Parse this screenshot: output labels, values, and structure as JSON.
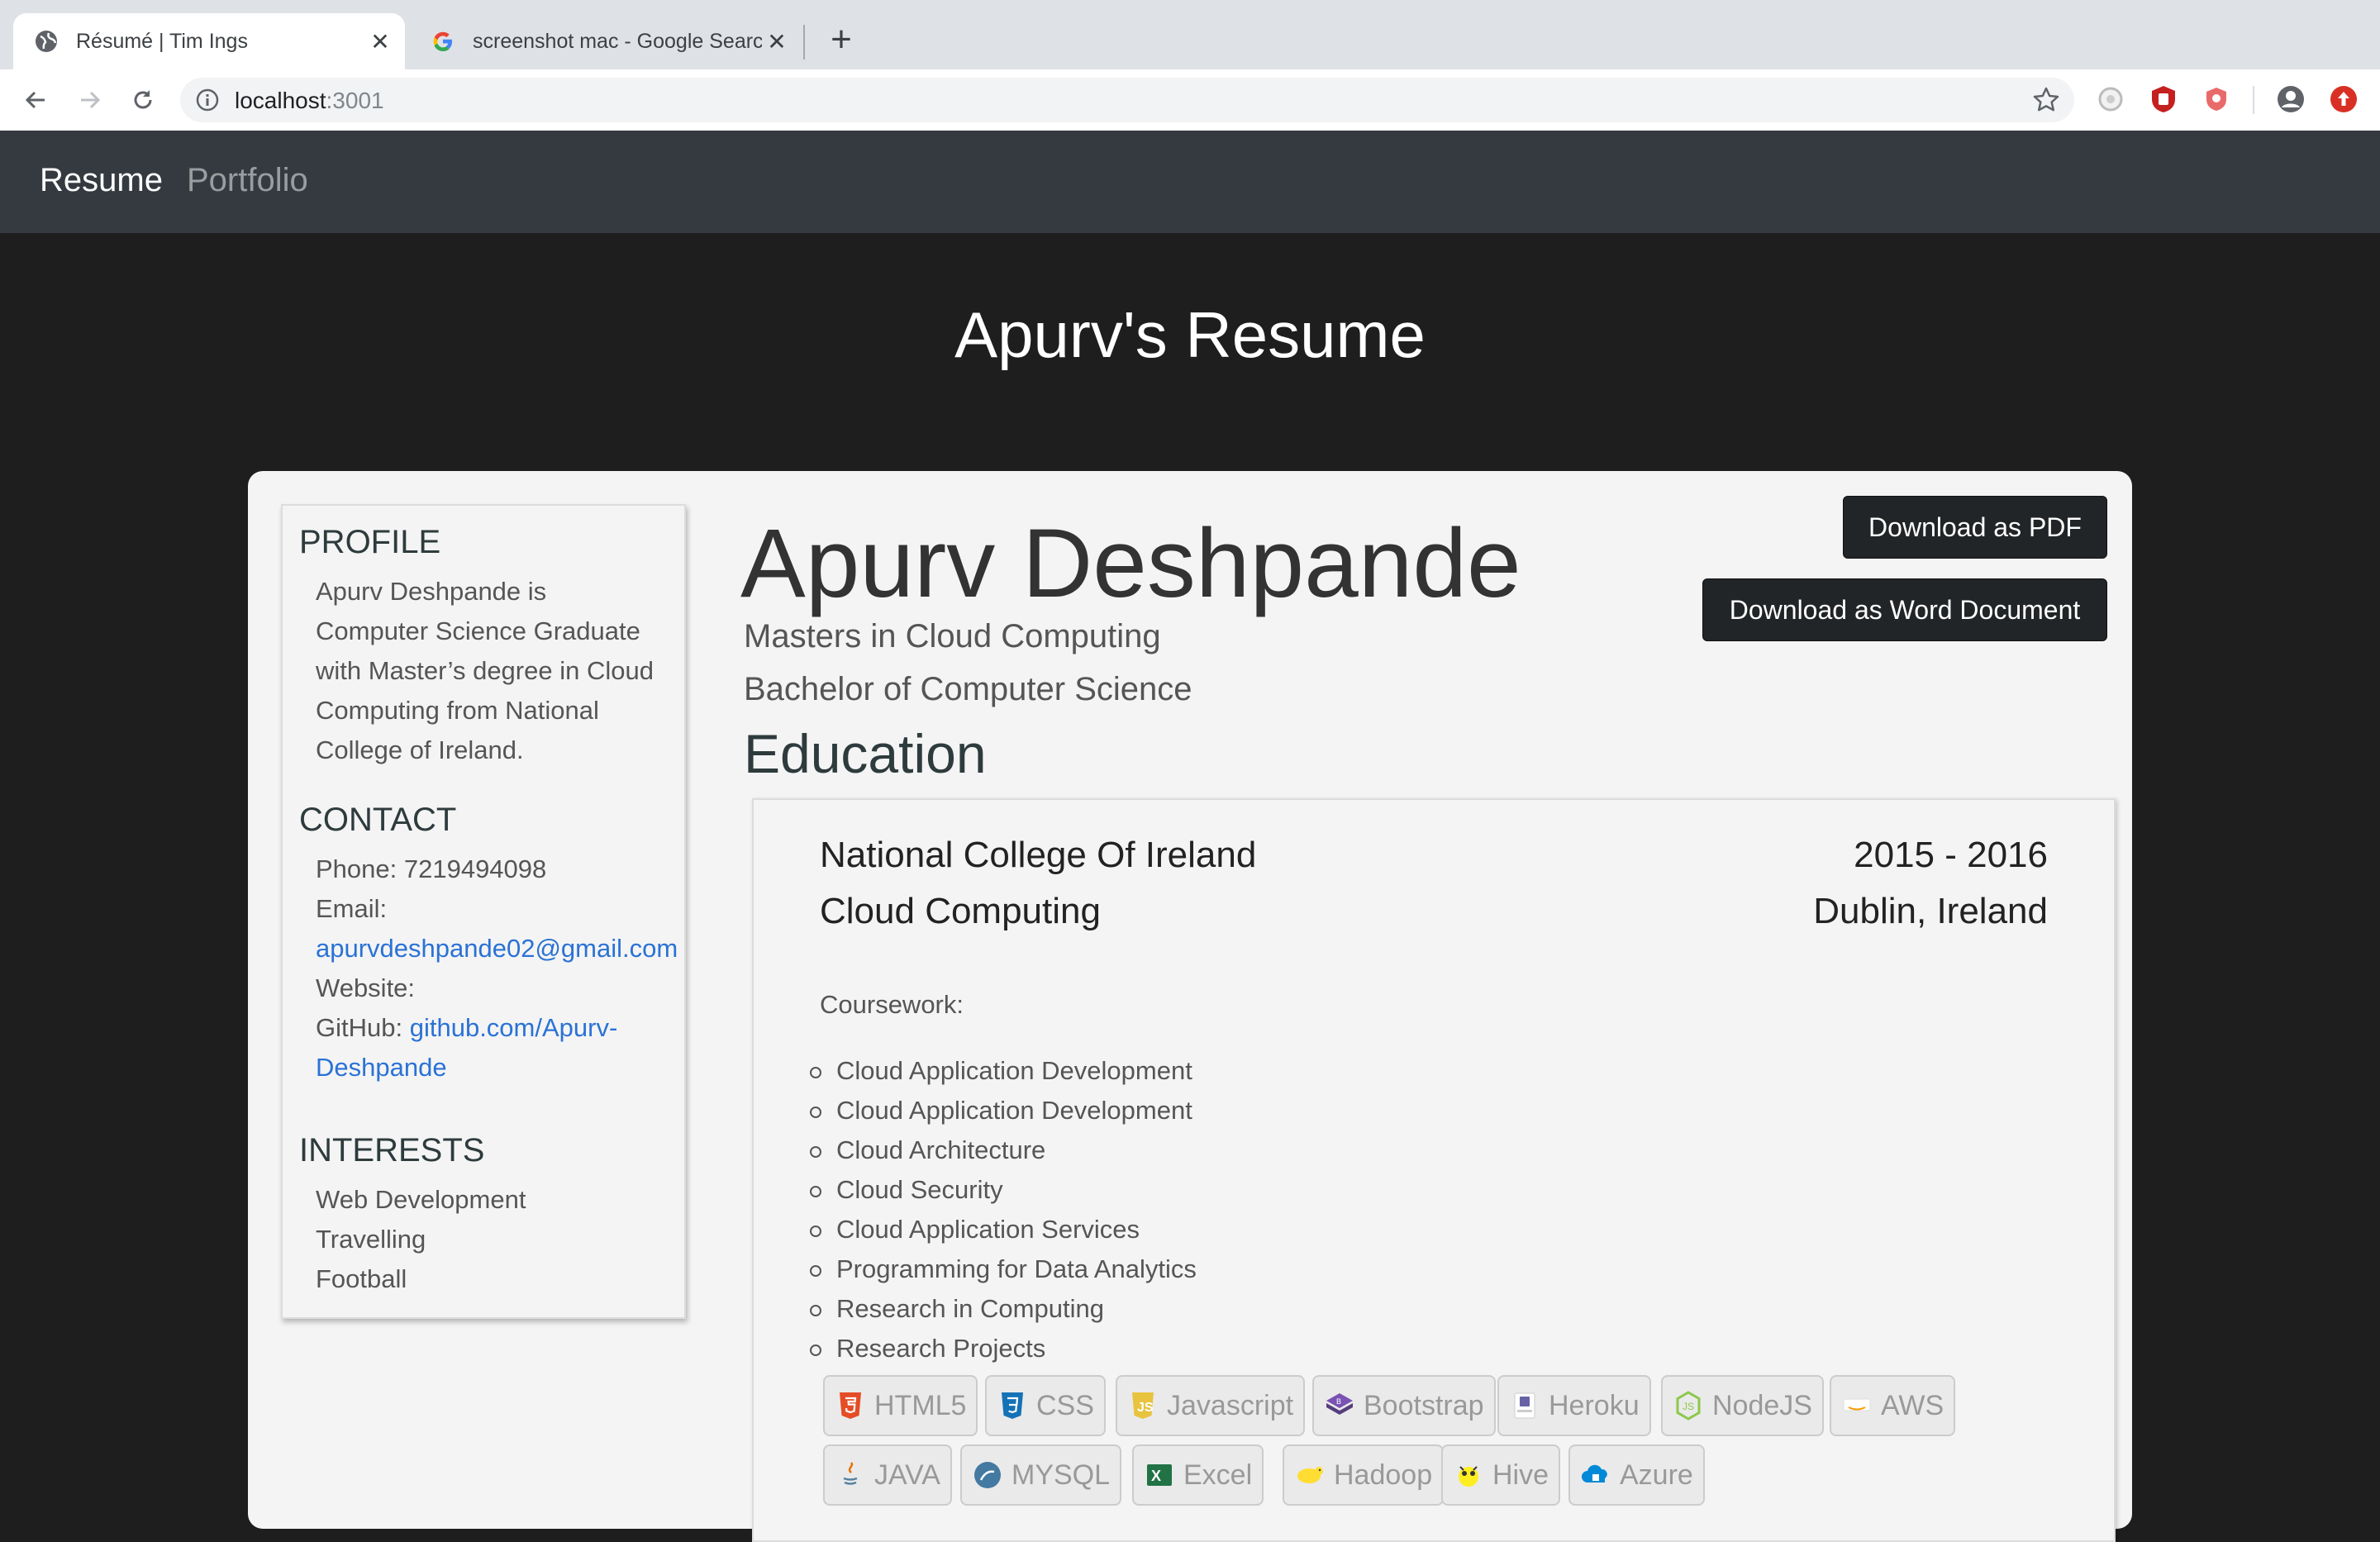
{
  "browser": {
    "tabs": [
      {
        "title": "Résumé | Tim Ings",
        "icon": "globe-icon",
        "active": true
      },
      {
        "title": "screenshot mac - Google Searc",
        "icon": "google-icon",
        "active": false
      }
    ],
    "address": {
      "host": "localhost",
      "port": ":3001"
    }
  },
  "nav": {
    "items": [
      "Resume",
      "Portfolio"
    ]
  },
  "page_title": "Apurv's Resume",
  "sidebar": {
    "profile": {
      "heading": "PROFILE",
      "lines": [
        "Apurv Deshpande is",
        "Computer Science Graduate",
        "with Master’s degree in Cloud",
        "Computing from National",
        "College of Ireland."
      ]
    },
    "contact": {
      "heading": "CONTACT",
      "phone": "Phone: 7219494098",
      "email_label": "Email:",
      "email": "apurvdeshpande02@gmail.com",
      "website_label": "Website:",
      "github_label": "GitHub:",
      "github_line1": "github.com/Apurv-",
      "github_line2": "Deshpande"
    },
    "interests": {
      "heading": "INTERESTS",
      "items": [
        "Web Development",
        "Travelling",
        "Football"
      ]
    }
  },
  "main": {
    "name": "Apurv Deshpande",
    "degrees": [
      "Masters in Cloud Computing",
      "Bachelor of Computer Science"
    ],
    "download_pdf": "Download as PDF",
    "download_word": "Download as Word Document",
    "education_heading": "Education"
  },
  "education": {
    "school": "National College Of Ireland",
    "years": "2015 - 2016",
    "program": "Cloud Computing",
    "location": "Dublin, Ireland",
    "coursework_label": "Coursework:",
    "courses": [
      "Cloud Application Development",
      "Cloud Application Development",
      "Cloud Architecture",
      "Cloud Security",
      "Cloud Application Services",
      "Programming for Data Analytics",
      "Research in Computing",
      "Research Projects"
    ],
    "skills": [
      {
        "label": "HTML5",
        "icon": "html5-icon"
      },
      {
        "label": "CSS",
        "icon": "css3-icon"
      },
      {
        "label": "Javascript",
        "icon": "javascript-icon"
      },
      {
        "label": "Bootstrap",
        "icon": "bootstrap-icon"
      },
      {
        "label": "Heroku",
        "icon": "heroku-icon"
      },
      {
        "label": "NodeJS",
        "icon": "nodejs-icon"
      },
      {
        "label": "AWS",
        "icon": "aws-icon"
      },
      {
        "label": "JAVA",
        "icon": "java-icon"
      },
      {
        "label": "MYSQL",
        "icon": "mysql-icon"
      },
      {
        "label": "Excel",
        "icon": "excel-icon"
      },
      {
        "label": "Hadoop",
        "icon": "hadoop-icon"
      },
      {
        "label": "Hive",
        "icon": "hive-icon"
      },
      {
        "label": "Azure",
        "icon": "azure-icon"
      }
    ]
  },
  "colors": {
    "navbar": "#343a40",
    "page_bg": "#1e1e1f",
    "card_bg": "#f4f4f4",
    "link": "#2a72d6",
    "button": "#222527"
  }
}
